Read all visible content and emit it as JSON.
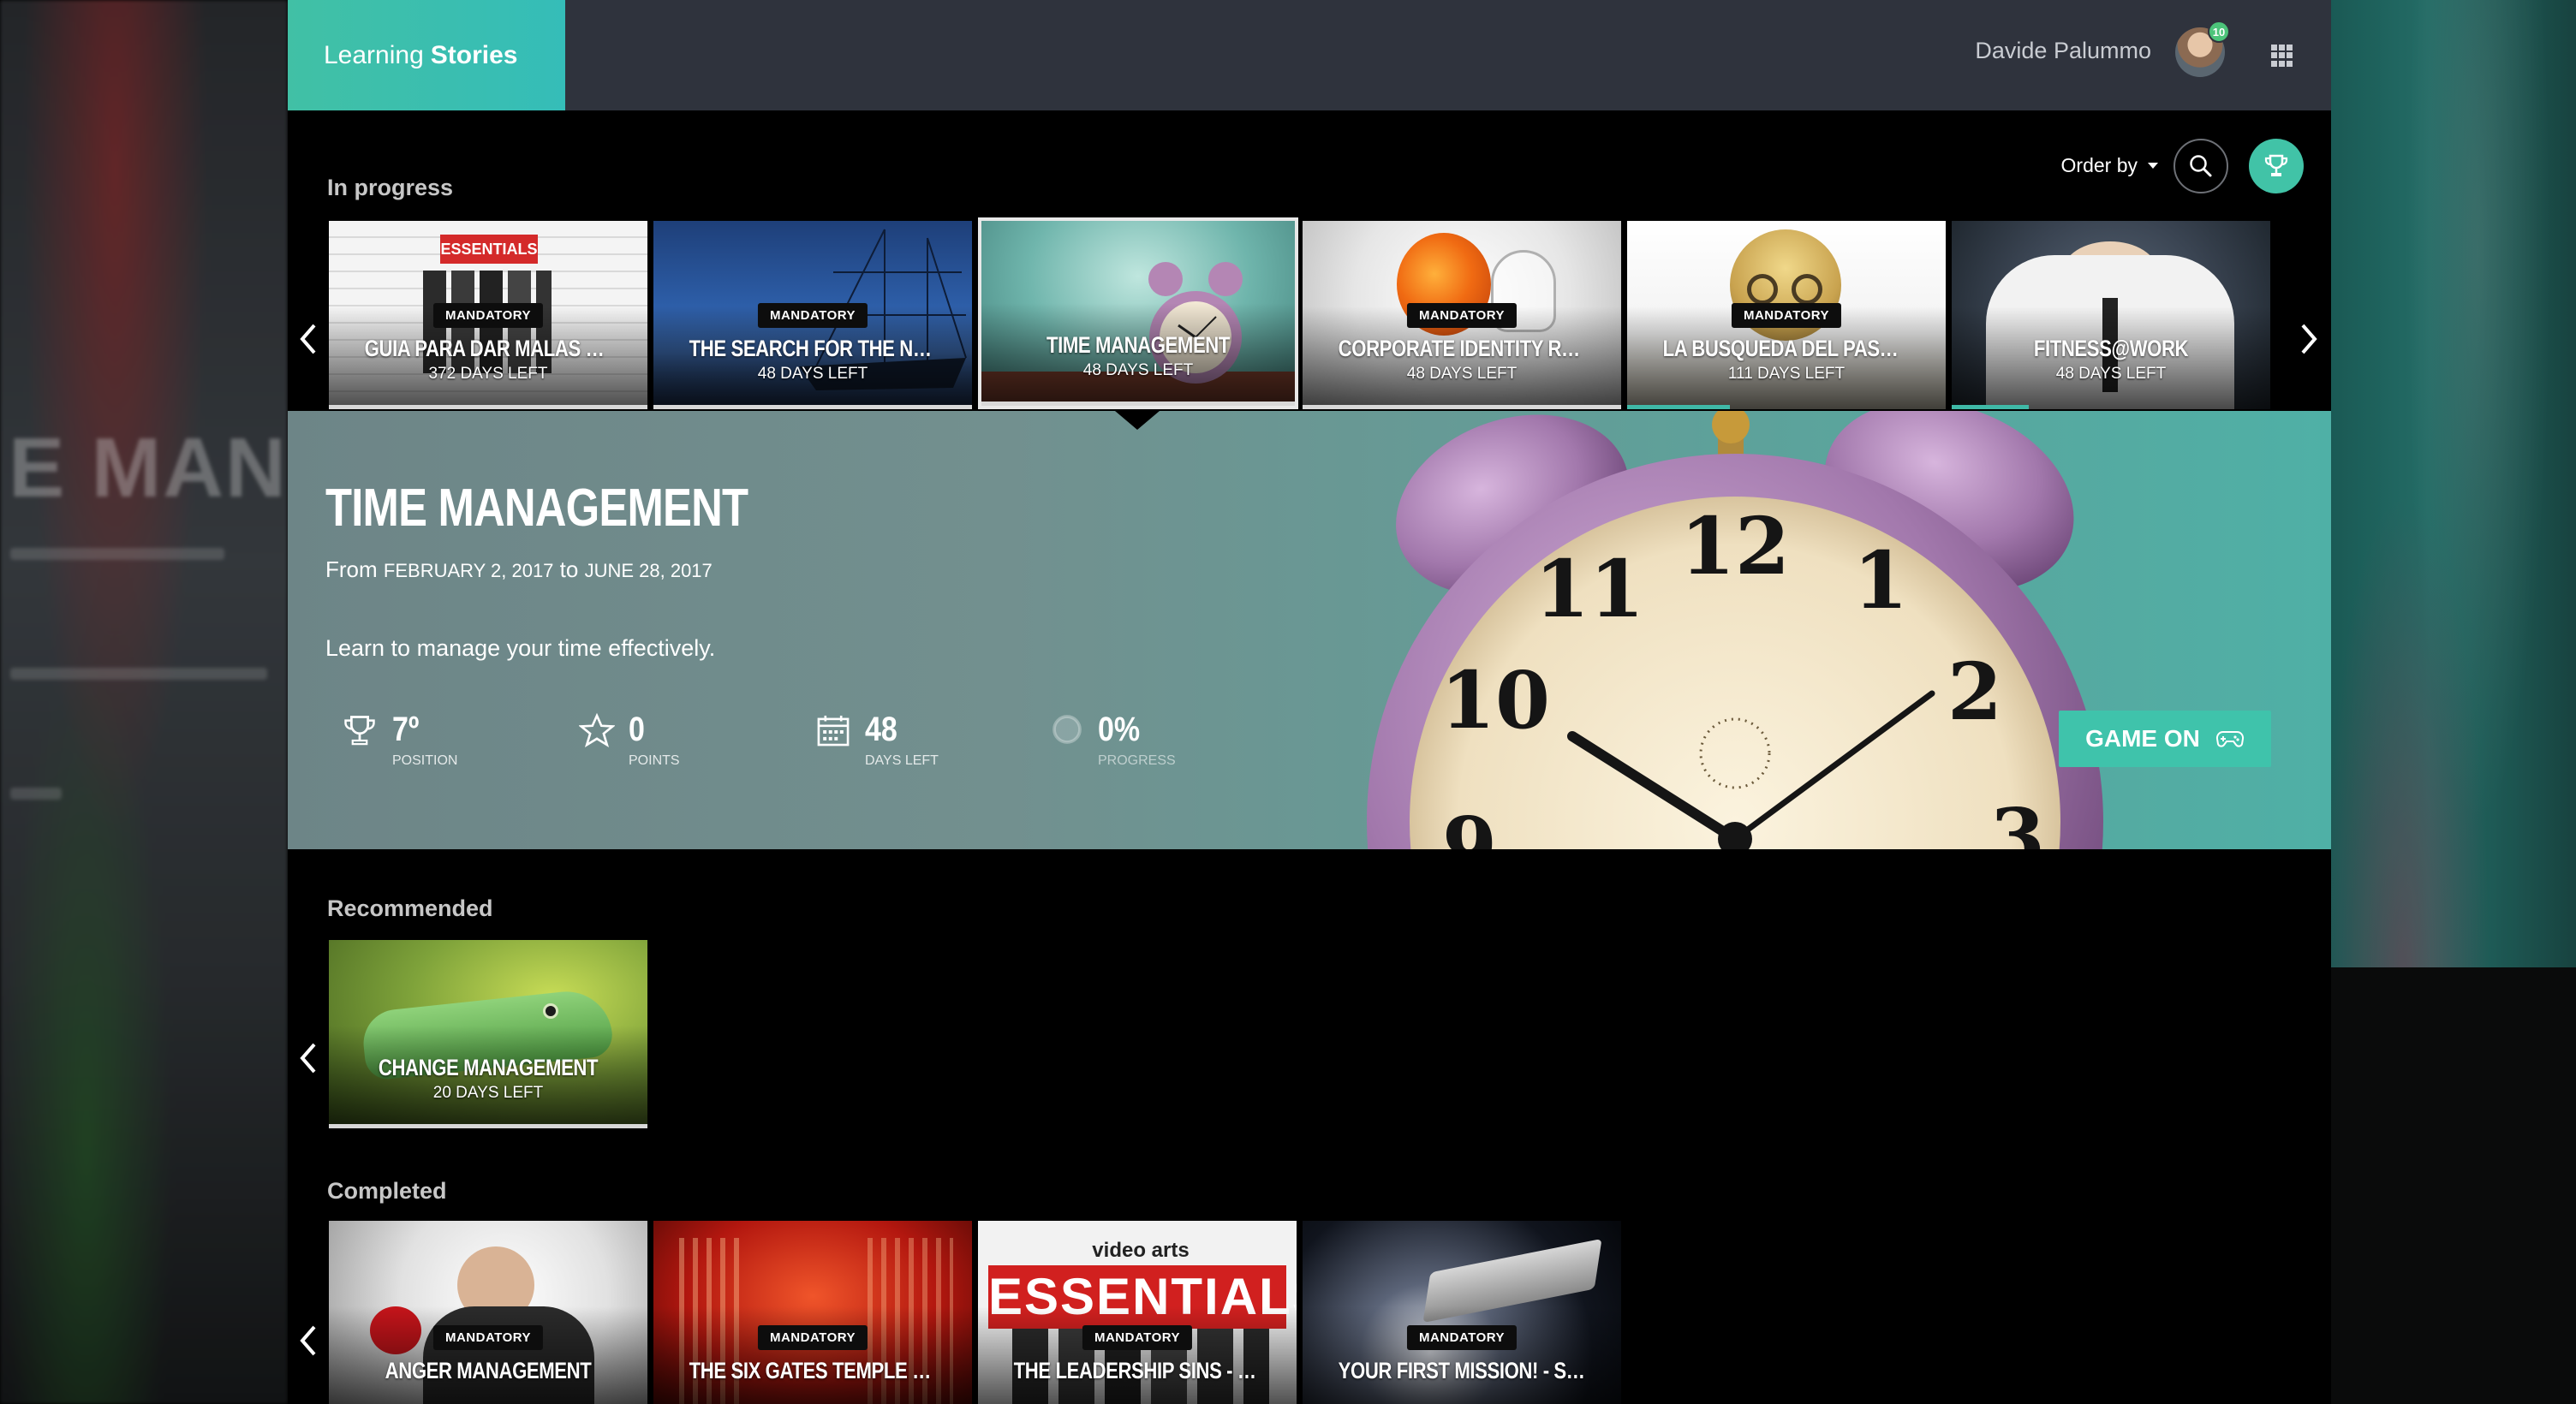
{
  "brand": {
    "part1": "Learning",
    "part2": "Stories"
  },
  "user": {
    "name": "Davide Palummo",
    "badge": "10"
  },
  "in_progress": {
    "title": "In progress",
    "order_by": "Order by",
    "cards": [
      {
        "badge": "MANDATORY",
        "title": "GUIA PARA DAR MALAS NOTICIAS",
        "days": "372 DAYS LEFT"
      },
      {
        "badge": "MANDATORY",
        "title": "THE SEARCH FOR THE NORTHW...",
        "days": "48 DAYS LEFT"
      },
      {
        "badge": "",
        "title": "TIME MANAGEMENT",
        "days": "48 DAYS LEFT"
      },
      {
        "badge": "MANDATORY",
        "title": "CORPORATE IDENTITY RECIPE",
        "days": "48 DAYS LEFT"
      },
      {
        "badge": "MANDATORY",
        "title": "LA BUSQUEDA DEL PASO DEL N...",
        "days": "111 DAYS LEFT"
      },
      {
        "badge": "",
        "title": "FITNESS@WORK",
        "days": "48 DAYS LEFT"
      }
    ]
  },
  "detail": {
    "title": "TIME MANAGEMENT",
    "from_label": "From",
    "from_date": "FEBRUARY 2, 2017",
    "to_label": "to",
    "to_date": "JUNE 28, 2017",
    "description": "Learn to manage your time effectively.",
    "stats": {
      "position": {
        "value": "7º",
        "label": "POSITION"
      },
      "points": {
        "value": "0",
        "label": "POINTS"
      },
      "days": {
        "value": "48",
        "label": "DAYS LEFT"
      },
      "progress": {
        "value": "0%",
        "label": "PROGRESS"
      }
    },
    "game_on": "GAME ON"
  },
  "recommended": {
    "title": "Recommended",
    "cards": [
      {
        "badge": "",
        "title": "CHANGE MANAGEMENT",
        "days": "20 DAYS LEFT"
      }
    ]
  },
  "completed": {
    "title": "Completed",
    "cards": [
      {
        "badge": "MANDATORY",
        "title": "ANGER MANAGEMENT"
      },
      {
        "badge": "MANDATORY",
        "title": "THE SIX GATES TEMPLE - INTER..."
      },
      {
        "badge": "MANDATORY",
        "title": "THE LEADERSHIP SINS - STRUC..."
      },
      {
        "badge": "MANDATORY",
        "title": "YOUR FIRST MISSION! - STORYT..."
      }
    ]
  },
  "colors": {
    "accent": "#41c3a7",
    "topbar": "#2f333d",
    "background": "#000000"
  },
  "icons": [
    "apps-grid-icon",
    "search-icon",
    "trophy-icon",
    "chevron-left-icon",
    "chevron-right-icon",
    "star-icon",
    "calendar-icon",
    "gamepad-icon"
  ]
}
